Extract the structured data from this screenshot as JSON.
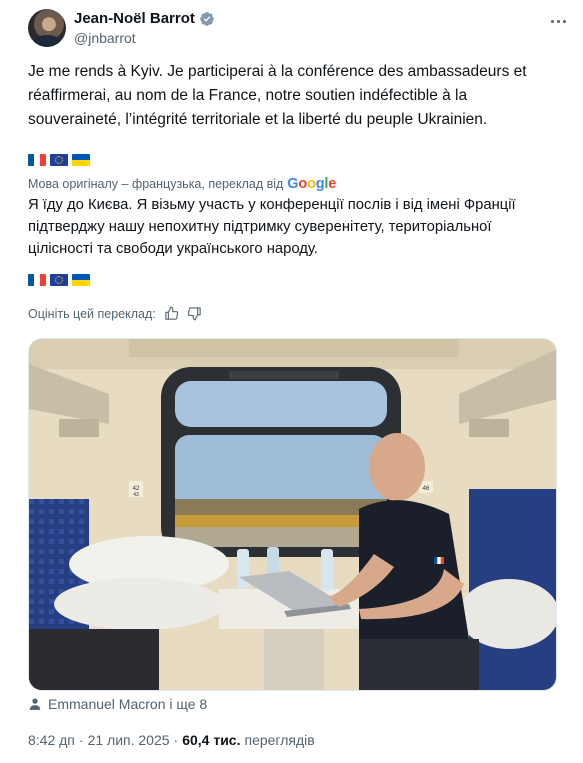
{
  "author": {
    "name": "Jean-Noël Barrot",
    "handle": "@jnbarrot"
  },
  "tweet": {
    "original_text": "Je me rends à Kyiv. Je participerai à la conférence des ambassadeurs et réaffirmerai, au nom de la France, notre soutien indéfectible à la souveraineté, l’intégrité territoriale et la liberté du peuple Ukrainien.",
    "flags": [
      "flag-france",
      "flag-eu",
      "flag-ukraine"
    ],
    "translation_note": "Мова оригіналу – французька, переклад від",
    "translation_provider": "Google",
    "translated_text": "Я їду до Києва. Я візьму участь у конференції послів і від імені Франції підтверджу нашу непохитну підтримку суверенітету, територіальної цілісності та свободи українського народу.",
    "rate_prompt": "Оцініть цей переклад:"
  },
  "photo": {
    "seat_number_left": "42",
    "seat_number_left_sub": "43",
    "seat_number_right": "46"
  },
  "tagged": "Emmanuel Macron і ще 8",
  "meta": {
    "time": "8:42 дп",
    "separator": "·",
    "date": "21 лип. 2025",
    "views_count": "60,4 тис.",
    "views_label": "переглядів"
  },
  "colors": {
    "text_primary": "#0f1419",
    "text_secondary": "#536471",
    "verified": "#1d9bf0"
  }
}
